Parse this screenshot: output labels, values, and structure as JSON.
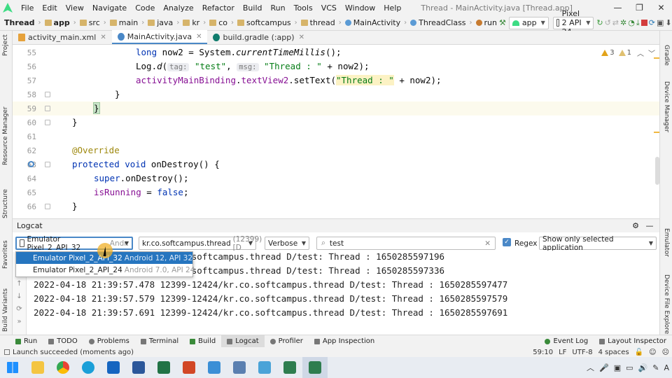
{
  "window": {
    "title": "Thread - MainActivity.java [Thread.app]",
    "controls": [
      "—",
      "❐",
      "✕"
    ]
  },
  "menu": [
    "File",
    "Edit",
    "View",
    "Navigate",
    "Code",
    "Analyze",
    "Refactor",
    "Build",
    "Run",
    "Tools",
    "VCS",
    "Window",
    "Help"
  ],
  "breadcrumb": [
    "Thread",
    "app",
    "src",
    "main",
    "java",
    "kr",
    "co",
    "softcampus",
    "thread",
    "MainActivity",
    "ThreadClass",
    "run"
  ],
  "toolbar": {
    "run_config": "app",
    "device": "Pixel 2 API 24"
  },
  "left_strip": [
    "Project",
    "Resource Manager",
    "Structure",
    "Favorites",
    "Build Variants"
  ],
  "right_strip": [
    "Gradle",
    "Device Manager",
    "Emulator",
    "Device File Explorer"
  ],
  "editor_tabs": [
    {
      "label": "activity_main.xml"
    },
    {
      "label": "MainActivity.java"
    },
    {
      "label": "build.gradle (:app)"
    }
  ],
  "editor": {
    "line_numbers": [
      "55",
      "56",
      "57",
      "58",
      "59",
      "60",
      "61",
      "62",
      "63",
      "64",
      "65",
      "66"
    ],
    "warnings": {
      "strong": "3",
      "weak": "1"
    },
    "code": {
      "l55_kw": "long",
      "l55_a": " now2 = System.",
      "l55_fn": "currentTimeMillis",
      "l55_b": "();",
      "l56_a": "Log.",
      "l56_fn": "d",
      "l56_b": "(",
      "l56_hint1": "tag:",
      "l56_str1": "\"test\"",
      "l56_c": ", ",
      "l56_hint2": "msg:",
      "l56_str2": "\"Thread : \"",
      "l56_d": " + now2);",
      "l57_fld": "activityMainBinding",
      "l57_a": ".",
      "l57_fld2": "textView2",
      "l57_b": ".setText(",
      "l57_str": "\"Thread : \"",
      "l57_c": " + now2);",
      "l58": "}",
      "l59": "}",
      "l60": "}",
      "l62_ann": "@Override",
      "l63_kw": "protected void",
      "l63_a": " onDestroy() {",
      "l64_kw": "super",
      "l64_a": ".onDestroy();",
      "l65_fld": "isRunning",
      "l65_a": " = ",
      "l65_kw": "false",
      "l65_b": ";",
      "l66": "}"
    }
  },
  "logcat": {
    "title": "Logcat",
    "device_select": "Emulator Pixel_2_API_32",
    "device_select_tail": "Andr.",
    "process_select": "kr.co.softcampus.thread",
    "process_pid": "(12399) [D",
    "level_select": "Verbose",
    "search_value": "test",
    "regex_label": "Regex",
    "filter_select": "Show only selected application",
    "device_options": [
      {
        "name": "Emulator Pixel_2_API_32",
        "detail": "Android 12, API 32"
      },
      {
        "name": "Emulator Pixel_2_API_24",
        "detail": "Android 7.0, API 24"
      }
    ],
    "lines": [
      "                  12424/kr.co.softcampus.thread D/test: Thread : 1650285597196",
      "                  12424/kr.co.softcampus.thread D/test: Thread : 1650285597336",
      "2022-04-18 21:39:57.478 12399-12424/kr.co.softcampus.thread D/test: Thread : 1650285597477",
      "2022-04-18 21:39:57.579 12399-12424/kr.co.softcampus.thread D/test: Thread : 1650285597579",
      "2022-04-18 21:39:57.691 12399-12424/kr.co.softcampus.thread D/test: Thread : 1650285597691"
    ]
  },
  "bottom_tabs": [
    "Run",
    "TODO",
    "Problems",
    "Terminal",
    "Build",
    "Logcat",
    "Profiler",
    "App Inspection"
  ],
  "bottom_right": [
    "Event Log",
    "Layout Inspector"
  ],
  "status": {
    "message": "Launch succeeded (moments ago)",
    "position": "59:10",
    "line_sep": "LF",
    "encoding": "UTF-8",
    "indent": "4 spaces"
  },
  "colors": {
    "accent": "#4a88c7",
    "selection": "#2675bf",
    "android_green": "#3ddc84"
  }
}
